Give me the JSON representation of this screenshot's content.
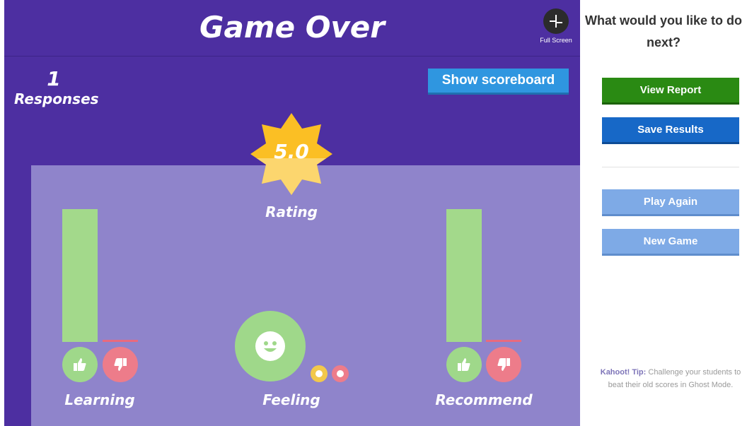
{
  "header": {
    "title": "Game Over",
    "fullscreen_label": "Full Screen",
    "fullscreen_icon": "collapse-icon"
  },
  "summary": {
    "responses_count": "1",
    "responses_label": "Responses",
    "scoreboard_button": "Show scoreboard"
  },
  "rating": {
    "value": "5.0",
    "label": "Rating"
  },
  "learning": {
    "label": "Learning",
    "positive_share": 1.0,
    "negative_share": 0.0,
    "up_icon": "thumbs-up-icon",
    "down_icon": "thumbs-down-icon"
  },
  "feeling": {
    "label": "Feeling",
    "selected": "happy",
    "icons": [
      "happy-face-icon",
      "neutral-face-icon",
      "sad-face-icon"
    ]
  },
  "recommend": {
    "label": "Recommend",
    "positive_share": 1.0,
    "negative_share": 0.0,
    "up_icon": "thumbs-up-icon",
    "down_icon": "thumbs-down-icon"
  },
  "sidebar": {
    "question": "What would you like to do next?",
    "buttons": {
      "view_report": "View Report",
      "save_results": "Save Results",
      "play_again": "Play Again",
      "new_game": "New Game"
    },
    "tip_label": "Kahoot! Tip:",
    "tip_text": "Challenge your students to beat their old scores in Ghost Mode."
  },
  "colors": {
    "main_purple": "#4d2fa1",
    "panel_purple": "#8f84cb",
    "positive_green": "#9fd88a",
    "negative_red": "#ed7c8a",
    "rating_gold": "#fbbf24",
    "report_green": "#2a8a13",
    "save_blue": "#1768c7",
    "light_blue": "#7eaae6"
  }
}
